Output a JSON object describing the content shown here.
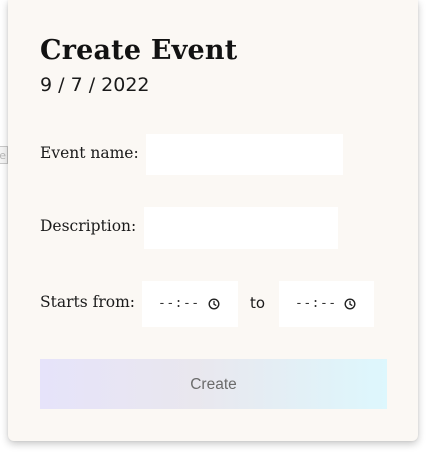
{
  "form": {
    "title": "Create Event",
    "date": "9 / 7 / 2022",
    "event_name_label": "Event name:",
    "event_name_value": "",
    "description_label": "Description:",
    "description_value": "",
    "starts_from_label": "Starts from:",
    "start_time_display": "--:--",
    "to_label": "to",
    "end_time_display": "--:--",
    "create_label": "Create",
    "clock_icon": "clock-icon"
  },
  "background_peek_text": "e",
  "colors": {
    "card_background": "#fbf8f4",
    "button_gradient_start": "#e6e3fa",
    "button_gradient_end": "#ddf7fd",
    "button_text": "#6b6b6b"
  }
}
